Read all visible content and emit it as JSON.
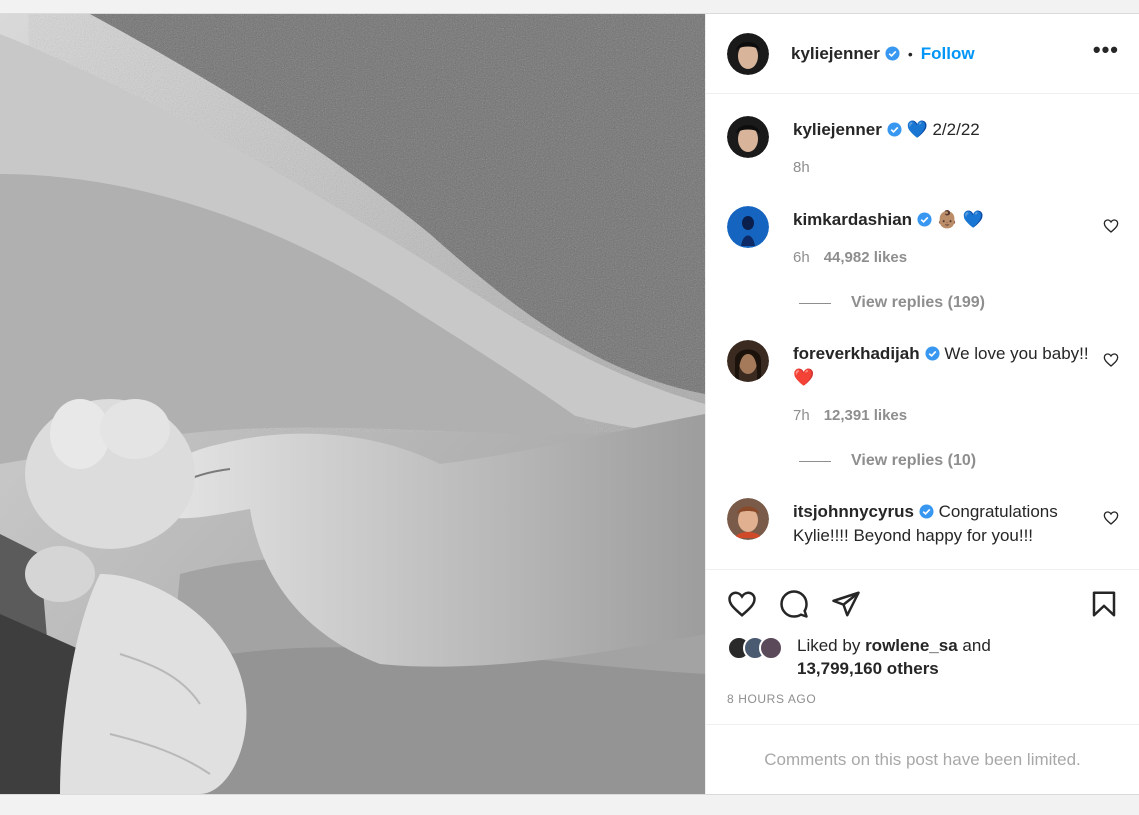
{
  "header": {
    "username": "kyliejenner",
    "dot": "•",
    "follow_label": "Follow",
    "more_label": "•••"
  },
  "caption": {
    "username": "kyliejenner",
    "date_text": "2/2/22",
    "emoji": "💙",
    "time": "8h"
  },
  "comments": [
    {
      "username": "kimkardashian",
      "text": "👶🏽 💙",
      "time": "6h",
      "likes": "44,982 likes",
      "replies": "View replies (199)"
    },
    {
      "username": "foreverkhadijah",
      "text": "We love you baby!! ❤️",
      "time": "7h",
      "likes": "12,391 likes",
      "replies": "View replies (10)"
    },
    {
      "username": "itsjohnnycyrus",
      "text": "Congratulations Kylie!!!! Beyond happy for you!!!"
    }
  ],
  "likes": {
    "prefix": "Liked by",
    "user": "rowlene_sa",
    "and": "and",
    "others": "13,799,160 others"
  },
  "time_ago": "8 HOURS AGO",
  "limited_text": "Comments on this post have been limited.",
  "icons": {
    "verified": "verified-badge-icon",
    "like": "heart-icon",
    "comment": "comment-bubble-icon",
    "share": "paper-plane-icon",
    "save": "bookmark-icon"
  },
  "colors": {
    "link_blue": "#0095f6",
    "verified_blue": "#3897f0",
    "meta_gray": "#8e8e8e",
    "text": "#262626"
  }
}
